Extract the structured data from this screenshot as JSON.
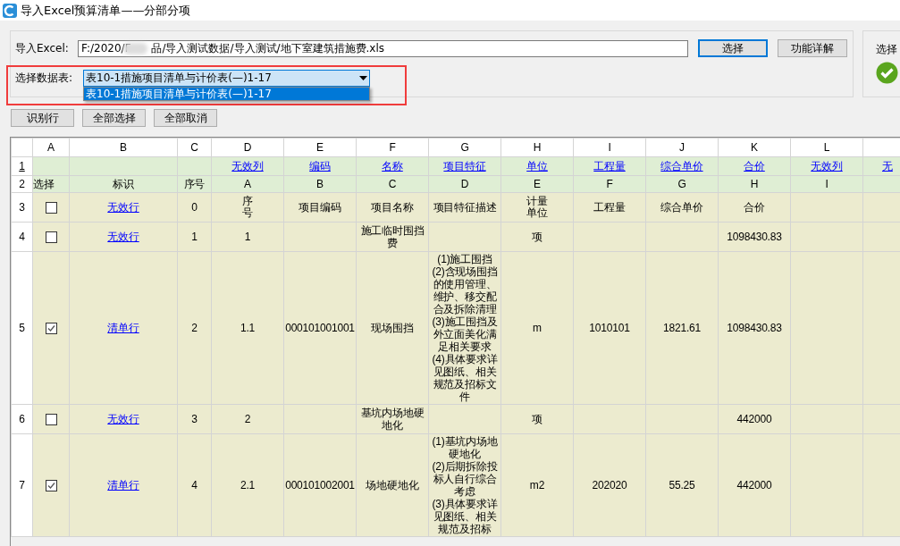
{
  "window": {
    "title": "导入Excel预算清单——分部分项"
  },
  "import": {
    "label": "导入Excel:",
    "path": "F:/2020/F      品/导入测试数据/导入测试/地下室建筑措施费.xls",
    "buttons": [
      {
        "label": "选择",
        "focused": true
      },
      {
        "label": "功能详解",
        "focused": false
      }
    ]
  },
  "sheet": {
    "label": "选择数据表:",
    "value": "表10-1措施项目清单与计价表(—)1-17",
    "highlighted": true,
    "options": [
      {
        "label": "表10-1措施项目清单与计价表(—)1-17",
        "selected": true
      }
    ]
  },
  "status_panel": {
    "label": "选择",
    "ok": true
  },
  "actions": [
    "识别行",
    "全部选择",
    "全部取消"
  ],
  "grid": {
    "mapping_row_number": "1",
    "source_row_number": "2",
    "columns": [
      {
        "letter": "A",
        "source": "选择"
      },
      {
        "letter": "B",
        "source": "标识"
      },
      {
        "letter": "C",
        "source": "序号"
      },
      {
        "letter": "D",
        "mapping": "无效列",
        "source": "A"
      },
      {
        "letter": "E",
        "mapping": "编码",
        "source": "B"
      },
      {
        "letter": "F",
        "mapping": "名称",
        "source": "C"
      },
      {
        "letter": "G",
        "mapping": "项目特征",
        "source": "D"
      },
      {
        "letter": "H",
        "mapping": "单位",
        "source": "E"
      },
      {
        "letter": "I",
        "mapping": "工程量",
        "source": "F"
      },
      {
        "letter": "J",
        "mapping": "综合单价",
        "source": "G"
      },
      {
        "letter": "K",
        "mapping": "合价",
        "source": "H"
      },
      {
        "letter": "L",
        "mapping": "无效列",
        "source": "I"
      },
      {
        "mapping": "无"
      }
    ],
    "rows": [
      {
        "number": "3",
        "checked": false,
        "tag": "无效行",
        "cells": {
          "C": "0",
          "D": {
            "text": "序号",
            "kind": "stacked"
          },
          "E": "项目编码",
          "F": "项目名称",
          "G": "项目特征描述",
          "H": {
            "text": "计量单位",
            "kind": "stacked"
          },
          "I": "工程量",
          "J": "综合单价",
          "K": "合价"
        }
      },
      {
        "number": "4",
        "checked": false,
        "tag": "无效行",
        "cells": {
          "C": "1",
          "D": "1",
          "F": "施工临时围挡费",
          "H": "项",
          "K": "1098430.83"
        }
      },
      {
        "number": "5",
        "checked": true,
        "tag": "清单行",
        "cells": {
          "C": "2",
          "D": "1.1",
          "E": "000101001001",
          "F": "现场围挡",
          "G": "(1)施工围挡\n(2)含现场围挡的使用管理、维护、移交配合及拆除清理\n(3)施工围挡及外立面美化满足相关要求\n(4)具体要求详见图纸、相关规范及招标文件",
          "H": "m",
          "I": "1010101",
          "J": "1821.61",
          "K": "1098430.83"
        }
      },
      {
        "number": "6",
        "checked": false,
        "tag": "无效行",
        "cells": {
          "C": "3",
          "D": "2",
          "F": "基坑内场地硬地化",
          "H": "项",
          "K": "442000"
        }
      },
      {
        "number": "7",
        "checked": true,
        "tag": "清单行",
        "cells": {
          "C": "4",
          "D": "2.1",
          "E": "000101002001",
          "F": "场地硬地化",
          "G": "(1)基坑内场地硬地化\n(2)后期拆除投标人自行综合考虑\n(3)具体要求详见图纸、相关规范及招标",
          "H": "m2",
          "I": "202020",
          "J": "55.25",
          "K": "442000"
        }
      }
    ]
  }
}
